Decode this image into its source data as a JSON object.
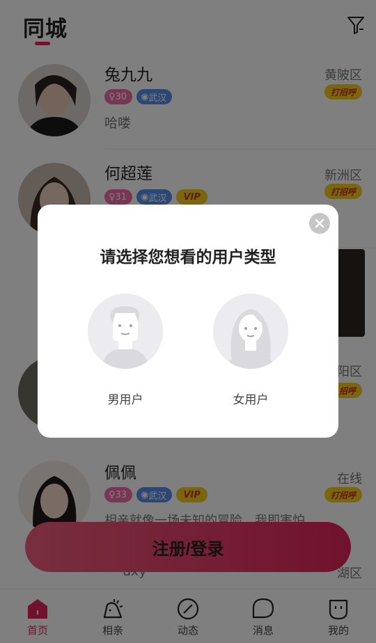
{
  "header": {
    "title": "同城"
  },
  "users": [
    {
      "name": "兔九九",
      "age": "30",
      "city": "武汉",
      "vip": "",
      "bio": "哈喽",
      "district": "黄陂区",
      "greet": "打招呼"
    },
    {
      "name": "何超莲",
      "age": "31",
      "city": "武汉",
      "vip": "VIP",
      "bio": "",
      "district": "新洲区",
      "greet": "打招呼"
    },
    {
      "name": "",
      "age": "",
      "city": "",
      "vip": "",
      "bio": "",
      "district": "阳区",
      "greet": "招呼"
    },
    {
      "name": "佩佩",
      "age": "33",
      "city": "武汉",
      "vip": "VIP",
      "bio": "相亲就像一场未知的冒险，我即害怕...",
      "district": "在线",
      "greet": "打招呼"
    },
    {
      "name": "",
      "age": "",
      "city": "",
      "vip": "",
      "bio": "uxy",
      "district": "湖区",
      "greet": ""
    }
  ],
  "register_button": "注册/登录",
  "modal": {
    "title": "请选择您想看的用户类型",
    "male_label": "男用户",
    "female_label": "女用户"
  },
  "nav": [
    {
      "label": "首页",
      "icon": "home-icon"
    },
    {
      "label": "相亲",
      "icon": "bag-icon"
    },
    {
      "label": "动态",
      "icon": "compass-icon"
    },
    {
      "label": "消息",
      "icon": "chat-icon"
    },
    {
      "label": "我的",
      "icon": "profile-icon"
    }
  ],
  "colors": {
    "accent": "#e2245a",
    "vip": "#f5cd1d",
    "age_tag": "#f36ca7",
    "city_tag": "#5b8fe6"
  }
}
